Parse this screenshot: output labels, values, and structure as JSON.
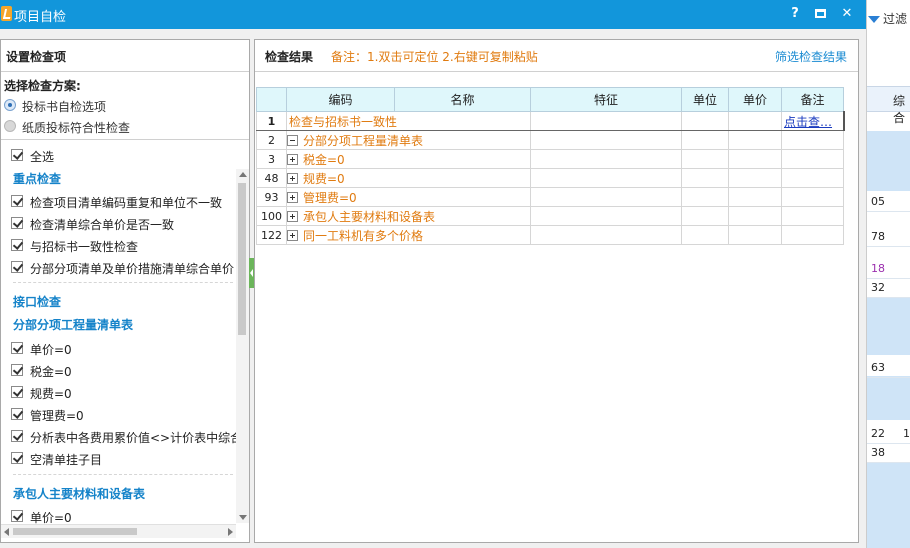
{
  "window": {
    "title": "项目自检",
    "help": "?",
    "close": "✕"
  },
  "background": {
    "filter_label": "过滤",
    "header": "综合",
    "values": [
      "05",
      "78",
      "18",
      "32",
      "63",
      "22",
      "1",
      "38"
    ]
  },
  "left": {
    "title": "设置检查项",
    "scheme_label": "选择检查方案:",
    "schemes": [
      {
        "label": "投标书自检选项",
        "selected": true
      },
      {
        "label": "纸质投标符合性检查",
        "selected": false
      }
    ],
    "select_all": "全选",
    "sections": {
      "key": "重点检查",
      "interface": "接口检查",
      "bill": "分部分项工程量清单表",
      "material": "承包人主要材料和设备表"
    },
    "key_items": [
      "检查项目清单编码重复和单位不一致",
      "检查清单综合单价是否一致",
      "与招标书一致性检查",
      "分部分项清单及单价措施清单综合单价"
    ],
    "bill_items": [
      "单价=0",
      "税金=0",
      "规费=0",
      "管理费=0",
      "分析表中各费用累价值<>计价表中综合",
      "空清单挂子目"
    ],
    "material_items": [
      "单价=0"
    ]
  },
  "right": {
    "title": "检查结果",
    "note": "备注：1.双击可定位 2.右键可复制粘贴",
    "filter_link": "筛选检查结果",
    "columns": [
      "编码",
      "名称",
      "特征",
      "单位",
      "单价",
      "备注"
    ],
    "rows": [
      {
        "n": "1",
        "code": "检查与招标书一致性",
        "remark": "点击查…"
      },
      {
        "n": "2",
        "name": "分部分项工程量清单表",
        "expand": "minus",
        "level": 1
      },
      {
        "n": "3",
        "name": "税金=0",
        "expand": "plus",
        "level": 2
      },
      {
        "n": "48",
        "name": "规费=0",
        "expand": "plus",
        "level": 2
      },
      {
        "n": "93",
        "name": "管理费=0",
        "expand": "plus",
        "level": 2
      },
      {
        "n": "100",
        "name": "承包人主要材料和设备表",
        "expand": "plus",
        "level": 1
      },
      {
        "n": "122",
        "name": "同一工料机有多个价格",
        "expand": "plus",
        "level": 1
      }
    ]
  }
}
